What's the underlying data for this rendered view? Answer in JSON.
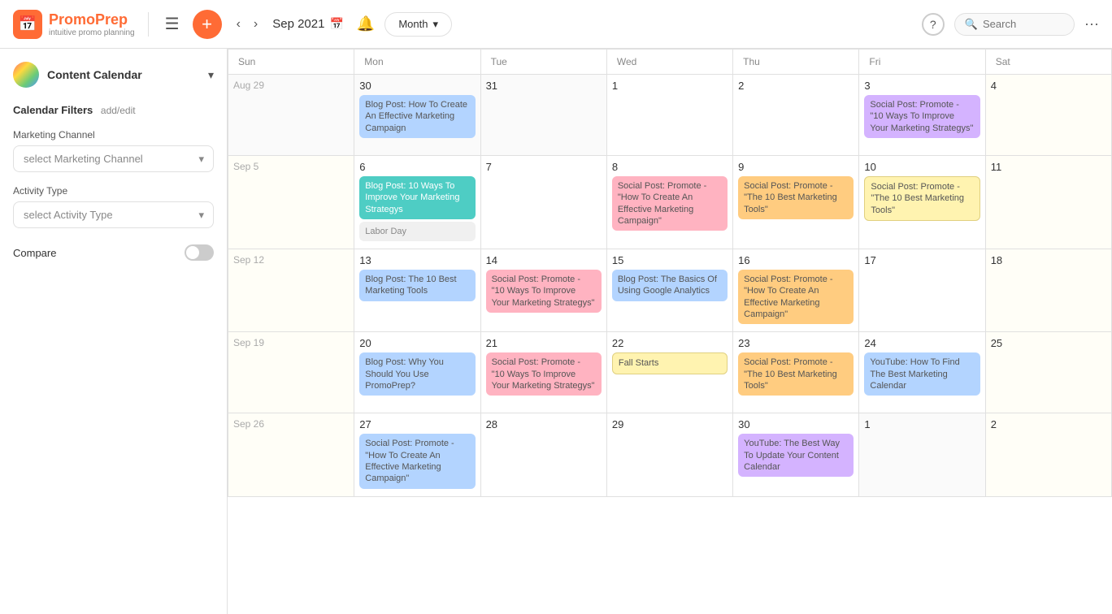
{
  "header": {
    "logo_name": "PromoPrep",
    "logo_sub": "intuitive promo planning",
    "current_month": "Sep 2021",
    "month_button": "Month",
    "search_placeholder": "Search",
    "add_button": "+",
    "help_label": "?",
    "more_label": "···"
  },
  "sidebar": {
    "title": "Content Calendar",
    "filters_label": "Calendar Filters",
    "filters_edit": "add/edit",
    "marketing_channel_label": "Marketing Channel",
    "marketing_channel_placeholder": "select Marketing Channel",
    "activity_type_label": "Activity Type",
    "activity_type_placeholder": "select Activity Type",
    "compare_label": "Compare"
  },
  "calendar": {
    "days_of_week": [
      "Sun",
      "Mon",
      "Tue",
      "Wed",
      "Thu",
      "Fri",
      "Sat"
    ],
    "weeks": [
      {
        "days": [
          {
            "date": "Aug 29",
            "label": "29",
            "week_label": "Aug 29",
            "other_month": true,
            "events": []
          },
          {
            "date": "30",
            "label": "30",
            "other_month": true,
            "events": [
              {
                "text": "Blog Post: How To Create An Effective Marketing Campaign",
                "color": "blue"
              }
            ]
          },
          {
            "date": "31",
            "label": "31",
            "other_month": true,
            "events": []
          },
          {
            "date": "Sep 1",
            "label": "1",
            "week_label": "Sep 1",
            "events": []
          },
          {
            "date": "2",
            "label": "2",
            "events": []
          },
          {
            "date": "3",
            "label": "3",
            "events": [
              {
                "text": "Social Post: Promote - \"10 Ways To Improve Your Marketing Strategys\"",
                "color": "purple"
              }
            ]
          },
          {
            "date": "4",
            "label": "4",
            "weekend": true,
            "events": []
          }
        ]
      },
      {
        "days": [
          {
            "date": "Sep 5",
            "label": "5",
            "week_label": "Sep 5",
            "weekend": true,
            "events": []
          },
          {
            "date": "6",
            "label": "6",
            "events": [
              {
                "text": "Blog Post: 10 Ways To Improve Your Marketing Strategys",
                "color": "green"
              },
              {
                "text": "Labor Day",
                "color": "gray"
              }
            ]
          },
          {
            "date": "7",
            "label": "7",
            "events": []
          },
          {
            "date": "8",
            "label": "8",
            "events": [
              {
                "text": "Social Post: Promote - \"How To Create An Effective Marketing Campaign\"",
                "color": "pink"
              }
            ]
          },
          {
            "date": "9",
            "label": "9",
            "events": [
              {
                "text": "Social Post: Promote - \"The 10 Best Marketing Tools\"",
                "color": "orange"
              }
            ]
          },
          {
            "date": "10",
            "label": "10",
            "events": [
              {
                "text": "Social Post: Promote - \"The 10 Best Marketing Tools\"",
                "color": "yellow"
              }
            ]
          },
          {
            "date": "11",
            "label": "11",
            "weekend": true,
            "events": []
          }
        ]
      },
      {
        "days": [
          {
            "date": "Sep 12",
            "label": "12",
            "week_label": "Sep 12",
            "weekend": true,
            "events": []
          },
          {
            "date": "13",
            "label": "13",
            "events": [
              {
                "text": "Blog Post: The 10 Best Marketing Tools",
                "color": "blue"
              }
            ]
          },
          {
            "date": "14",
            "label": "14",
            "events": [
              {
                "text": "Social Post: Promote - \"10 Ways To Improve Your Marketing Strategys\"",
                "color": "pink"
              }
            ]
          },
          {
            "date": "15",
            "label": "15",
            "events": [
              {
                "text": "Blog Post: The Basics Of Using Google Analytics",
                "color": "blue"
              }
            ]
          },
          {
            "date": "16",
            "label": "16",
            "events": [
              {
                "text": "Social Post: Promote - \"How To Create An Effective Marketing Campaign\"",
                "color": "orange"
              }
            ]
          },
          {
            "date": "17",
            "label": "17",
            "events": []
          },
          {
            "date": "18",
            "label": "18",
            "weekend": true,
            "events": []
          }
        ]
      },
      {
        "days": [
          {
            "date": "Sep 19",
            "label": "19",
            "week_label": "Sep 19",
            "weekend": true,
            "events": []
          },
          {
            "date": "20",
            "label": "20",
            "events": [
              {
                "text": "Blog Post: Why You Should You Use PromoPrep?",
                "color": "blue"
              }
            ]
          },
          {
            "date": "21",
            "label": "21",
            "events": [
              {
                "text": "Social Post: Promote - \"10 Ways To Improve Your Marketing Strategys\"",
                "color": "pink"
              }
            ]
          },
          {
            "date": "22",
            "label": "22",
            "events": [
              {
                "text": "Fall Starts",
                "color": "yellow"
              }
            ]
          },
          {
            "date": "23",
            "label": "23",
            "events": [
              {
                "text": "Social Post: Promote - \"The 10 Best Marketing Tools\"",
                "color": "orange"
              }
            ]
          },
          {
            "date": "24",
            "label": "24",
            "events": [
              {
                "text": "YouTube: How To Find The Best Marketing Calendar",
                "color": "blue"
              }
            ]
          },
          {
            "date": "25",
            "label": "25",
            "weekend": true,
            "events": []
          }
        ]
      },
      {
        "days": [
          {
            "date": "Sep 26",
            "label": "26",
            "week_label": "Sep 26",
            "weekend": true,
            "events": []
          },
          {
            "date": "27",
            "label": "27",
            "events": [
              {
                "text": "Social Post: Promote - \"How To Create An Effective Marketing Campaign\"",
                "color": "blue"
              }
            ]
          },
          {
            "date": "28",
            "label": "28",
            "events": []
          },
          {
            "date": "29",
            "label": "29",
            "events": []
          },
          {
            "date": "30",
            "label": "30",
            "events": [
              {
                "text": "YouTube: The Best Way To Update Your Content Calendar",
                "color": "purple"
              }
            ]
          },
          {
            "date": "Oct 1",
            "label": "1",
            "other_month": true,
            "events": []
          },
          {
            "date": "2",
            "label": "2",
            "other_month": true,
            "weekend": true,
            "events": []
          }
        ]
      }
    ]
  }
}
